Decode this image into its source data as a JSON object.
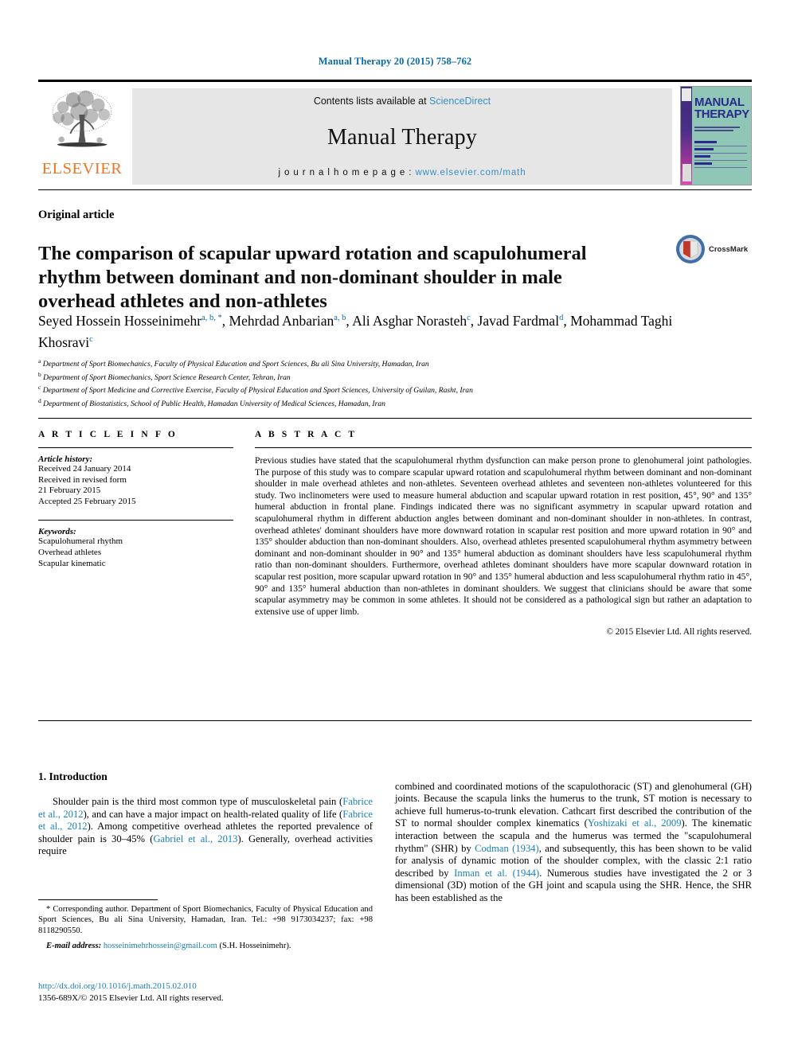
{
  "running_head": "Manual Therapy 20 (2015) 758–762",
  "masthead": {
    "elsevier_wordmark": "ELSEVIER",
    "contents_prefix": "Contents lists available at ",
    "contents_link": "ScienceDirect",
    "journal_title": "Manual Therapy",
    "homepage_prefix": "j o u r n a l   h o m e p a g e :   ",
    "homepage_url": "www.elsevier.com/math",
    "cover_title_line1": "MANUAL",
    "cover_title_line2": "THERAPY"
  },
  "article": {
    "type": "Original article",
    "title": "The comparison of scapular upward rotation and scapulohumeral rhythm between dominant and non-dominant shoulder in male overhead athletes and non-athletes",
    "crossmark_label": "CrossMark"
  },
  "authors": {
    "line1_name1": "Seyed Hossein Hosseinimehr",
    "line1_sup1": "a, b, *",
    "line1_name2": "Mehrdad Anbarian",
    "line1_sup2": "a, b",
    "line1_name3": "Ali Asghar Norasteh",
    "line1_sup3": "c",
    "line2_name1": "Javad Fardmal",
    "line2_sup1": "d",
    "line2_name2": "Mohammad Taghi Khosravi",
    "line2_sup2": "c"
  },
  "affiliations": [
    {
      "mark": "a",
      "text": "Department of Sport Biomechanics, Faculty of Physical Education and Sport Sciences, Bu ali Sina University, Hamadan, Iran"
    },
    {
      "mark": "b",
      "text": "Department of Sport Biomechanics, Sport Science Research Center, Tehran, Iran"
    },
    {
      "mark": "c",
      "text": "Department of Sport Medicine and Corrective Exercise, Faculty of Physical Education and Sport Sciences, University of Guilan, Rasht, Iran"
    },
    {
      "mark": "d",
      "text": "Department of Biostatistics, School of Public Health, Hamadan University of Medical Sciences, Hamadan, Iran"
    }
  ],
  "article_info": {
    "heading": "A R T I C L E  I N F O",
    "history_label": "Article history:",
    "history_lines": [
      "Received 24 January 2014",
      "Received in revised form",
      "21 February 2015",
      "Accepted 25 February 2015"
    ],
    "keywords_label": "Keywords:",
    "keywords": [
      "Scapulohumeral rhythm",
      "Overhead athletes",
      "Scapular kinematic"
    ]
  },
  "abstract": {
    "heading": "A B S T R A C T",
    "text": "Previous studies have stated that the scapulohumeral rhythm dysfunction can make person prone to glenohumeral joint pathologies. The purpose of this study was to compare scapular upward rotation and scapulohumeral rhythm between dominant and non-dominant shoulder in male overhead athletes and non-athletes. Seventeen overhead athletes and seventeen non-athletes volunteered for this study. Two inclinometers were used to measure humeral abduction and scapular upward rotation in rest position, 45°, 90° and 135° humeral abduction in frontal plane. Findings indicated there was no significant asymmetry in scapular upward rotation and scapulohumeral rhythm in different abduction angles between dominant and non-dominant shoulder in non-athletes. In contrast, overhead athletes' dominant shoulders have more downward rotation in scapular rest position and more upward rotation in 90° and 135° shoulder abduction than non-dominant shoulders. Also, overhead athletes presented scapulohumeral rhythm asymmetry between dominant and non-dominant shoulder in 90° and 135° humeral abduction as dominant shoulders have less scapulohumeral rhythm ratio than non-dominant shoulders. Furthermore, overhead athletes dominant shoulders have more scapular downward rotation in scapular rest position, more scapular upward rotation in 90° and 135° humeral abduction and less scapulohumeral rhythm ratio in 45°, 90° and 135° humeral abduction than non-athletes in dominant shoulders. We suggest that clinicians should be aware that some scapular asymmetry may be common in some athletes. It should not be considered as a pathological sign but rather an adaptation to extensive use of upper limb.",
    "copyright": "© 2015 Elsevier Ltd. All rights reserved."
  },
  "introduction": {
    "heading": "1. Introduction",
    "left_para_part1": "Shoulder pain is the third most common type of musculoskeletal pain (",
    "left_cite1": "Fabrice et al., 2012",
    "left_para_part2": "), and can have a major impact on health-related quality of life (",
    "left_cite2": "Fabrice et al., 2012",
    "left_para_part3": "). Among competitive overhead athletes the reported prevalence of shoulder pain is 30–45% (",
    "left_cite3": "Gabriel et al., 2013",
    "left_para_part4": "). Generally, overhead activities require",
    "right_part1": "combined and coordinated motions of the scapulothoracic (ST) and glenohumeral (GH) joints. Because the scapula links the humerus to the trunk, ST motion is necessary to achieve full humerus-to-trunk elevation. Cathcart first described the contribution of the ST to normal shoulder complex kinematics (",
    "right_cite1": "Yoshizaki et al., 2009",
    "right_part2": "). The kinematic interaction between the scapula and the humerus was termed the \"scapulohumeral rhythm\" (SHR) by ",
    "right_cite2": "Codman (1934)",
    "right_part3": ", and subsequently, this has been shown to be valid for analysis of dynamic motion of the shoulder complex, with the classic 2:1 ratio described by ",
    "right_cite3": "Inman et al. (1944)",
    "right_part4": ". Numerous studies have investigated the 2 or 3 dimensional (3D) motion of the GH joint and scapula using the SHR. Hence, the SHR has been established as the"
  },
  "footer": {
    "corresponding_marker": "*",
    "corresponding_text": " Corresponding author. Department of Sport Biomechanics, Faculty of Physical Education and Sport Sciences, Bu ali Sina University, Hamadan, Iran. Tel.: +98 9173034237; fax: +98 8118290550.",
    "email_label": "E-mail address:",
    "email": "hosseinimehrhossein@gmail.com",
    "email_owner": "(S.H. Hosseinimehr).",
    "doi": "http://dx.doi.org/10.1016/j.math.2015.02.010",
    "issn_line": "1356-689X/© 2015 Elsevier Ltd. All rights reserved."
  },
  "colors": {
    "link_blue": "#1a7fb5",
    "header_blue": "#0a6ca5",
    "elsevier_orange": "#ee7623",
    "banner_grey": "#e6e6e6",
    "cover_teal": "#8fc6b6"
  }
}
